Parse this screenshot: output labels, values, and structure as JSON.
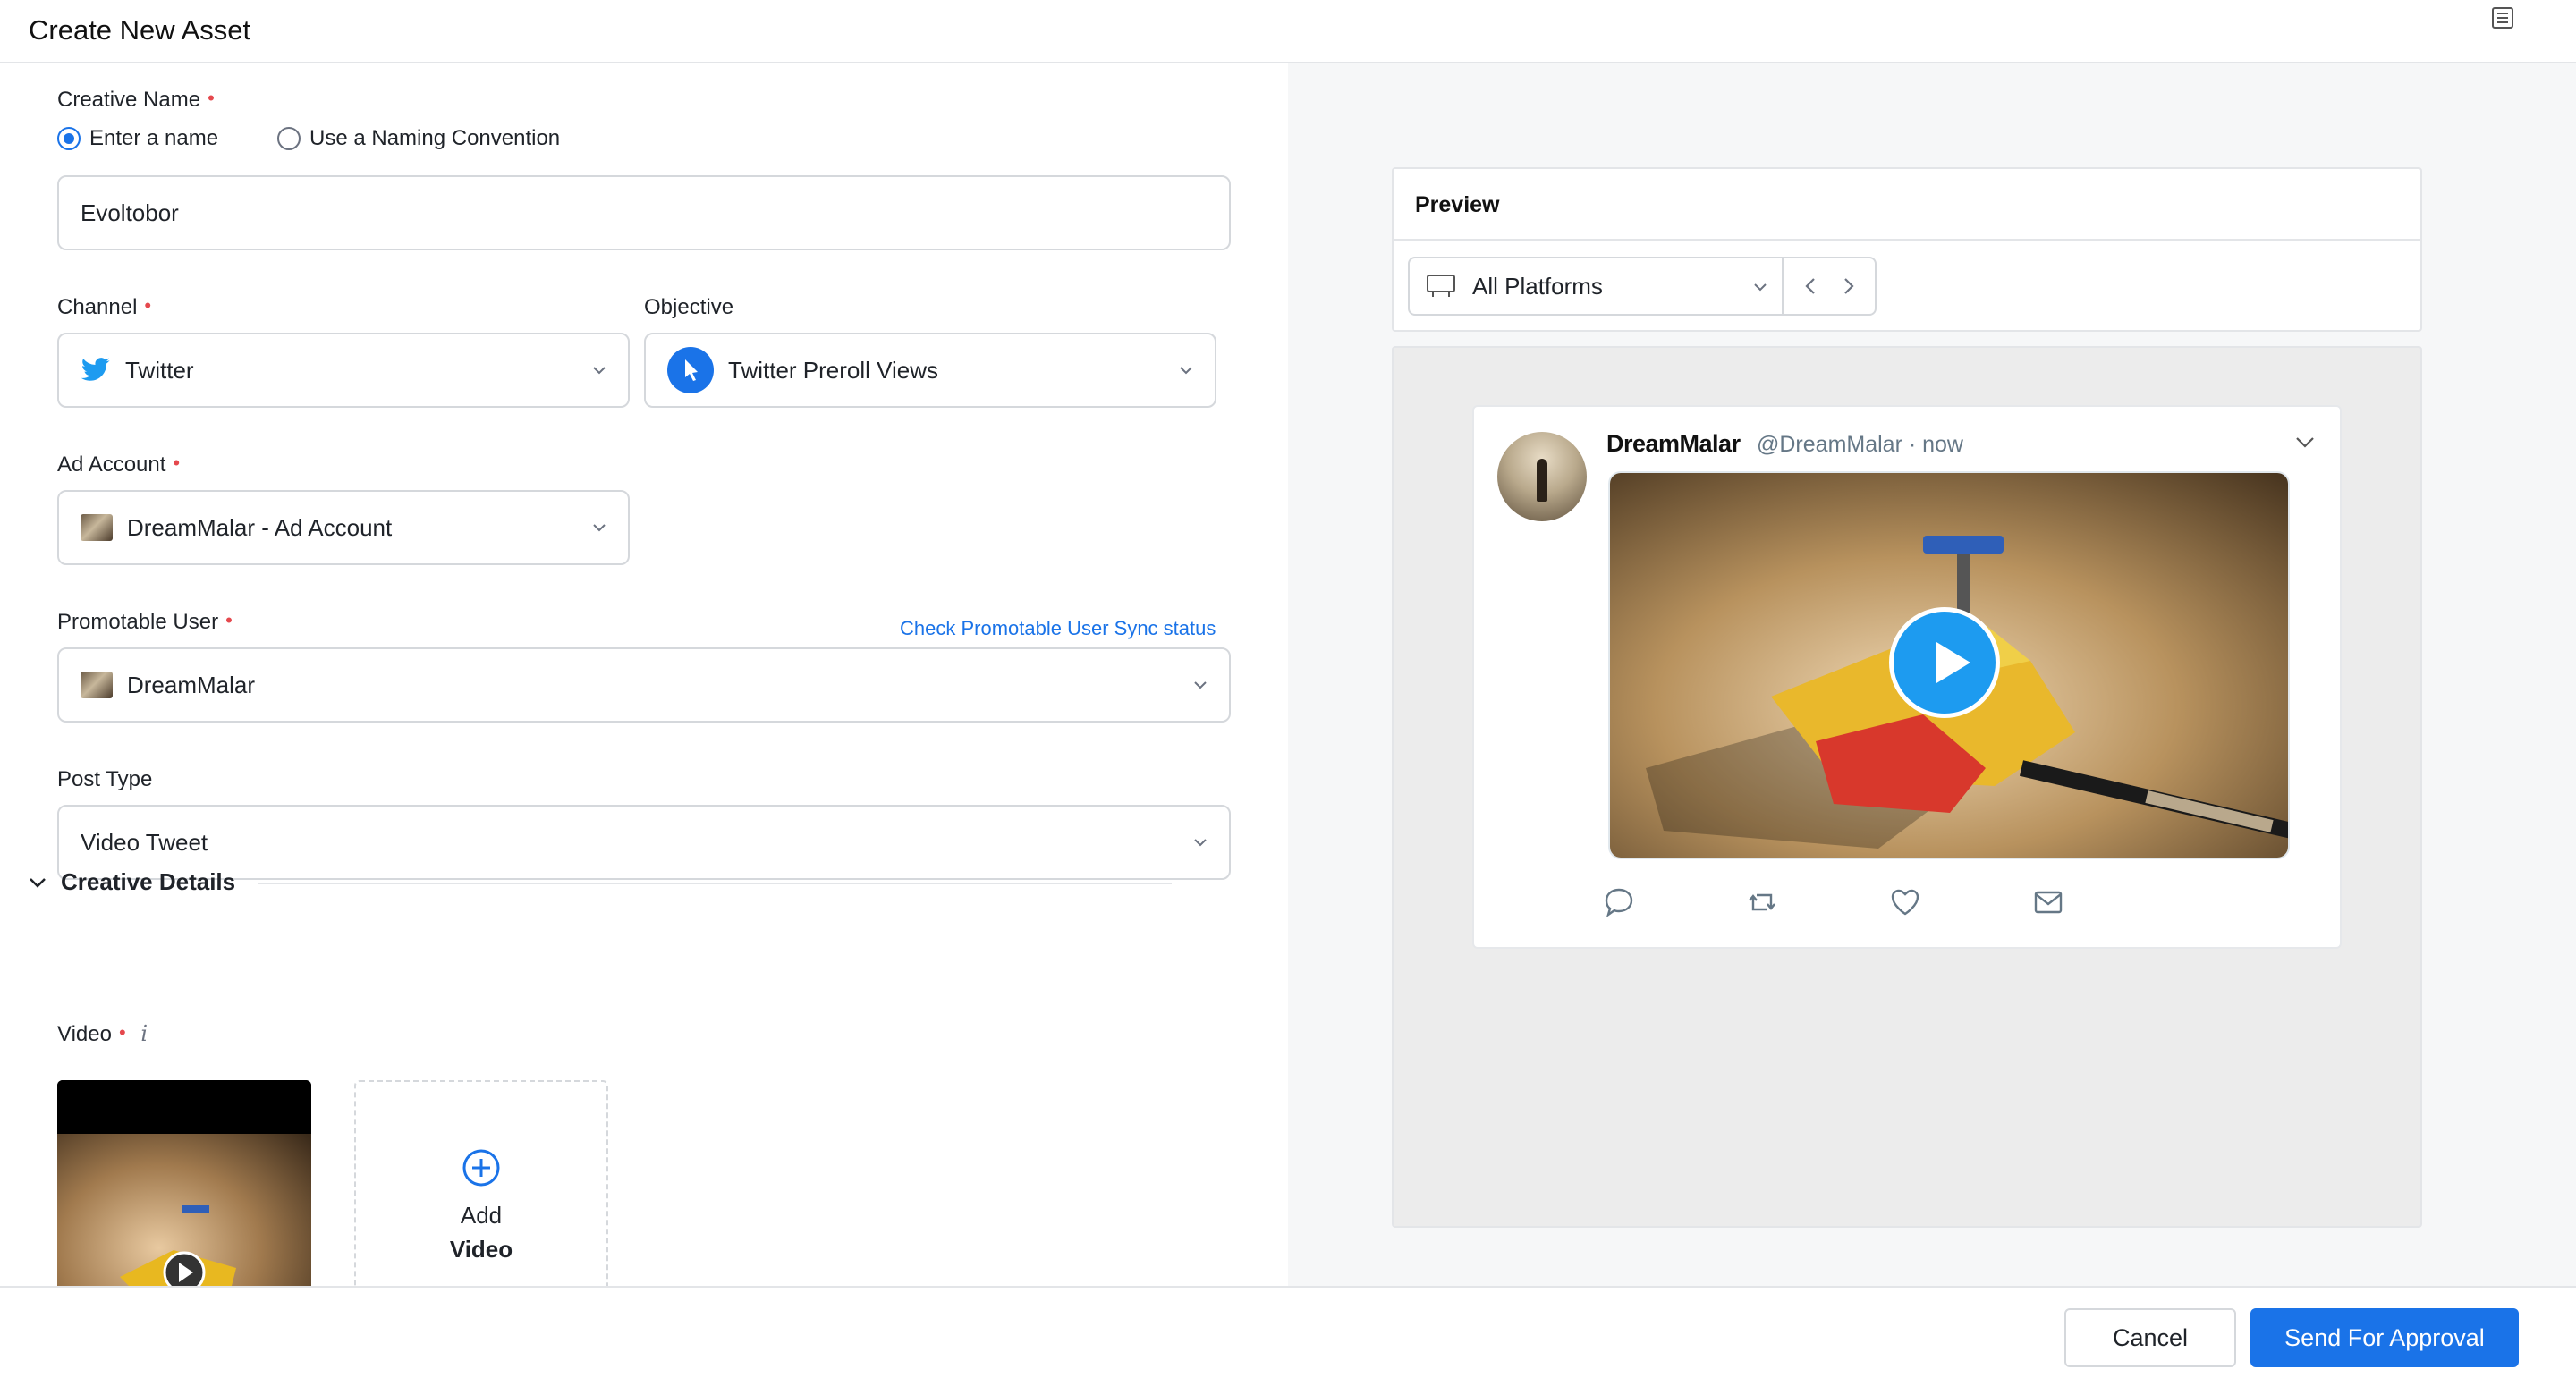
{
  "header": {
    "title": "Create New Asset",
    "menu_icon": "list-icon"
  },
  "form": {
    "creative_name": {
      "label": "Creative Name",
      "required_mark": "•",
      "radio_options": [
        "Enter a name",
        "Use a Naming Convention"
      ],
      "selected_option": "Enter a name",
      "value": "Evoltobor"
    },
    "channel": {
      "label": "Channel",
      "required_mark": "•",
      "value": "Twitter",
      "icon": "twitter-bird-icon"
    },
    "objective": {
      "label": "Objective",
      "value": "Twitter Preroll Views",
      "icon": "cursor-icon"
    },
    "ad_account": {
      "label": "Ad Account",
      "required_mark": "•",
      "value": "DreamMalar - Ad Account"
    },
    "promotable_user": {
      "label": "Promotable User",
      "required_mark": "•",
      "value": "DreamMalar",
      "sync_link": "Check Promotable User Sync status"
    },
    "post_type": {
      "label": "Post Type",
      "value": "Video Tweet"
    },
    "creative_details": {
      "label": "Creative Details"
    },
    "video": {
      "label": "Video",
      "required_mark": "•",
      "info_icon": "i",
      "add_label_1": "Add",
      "add_label_2": "Video"
    }
  },
  "preview": {
    "title": "Preview",
    "platform": "All Platforms",
    "tweet": {
      "display_name": "DreamMalar",
      "handle_time": "@DreamMalar · now"
    }
  },
  "footer": {
    "cancel": "Cancel",
    "send": "Send For Approval"
  },
  "colors": {
    "accent": "#1a73e8",
    "required": "#e5484d",
    "twitter_blue": "#1d9bf0"
  }
}
